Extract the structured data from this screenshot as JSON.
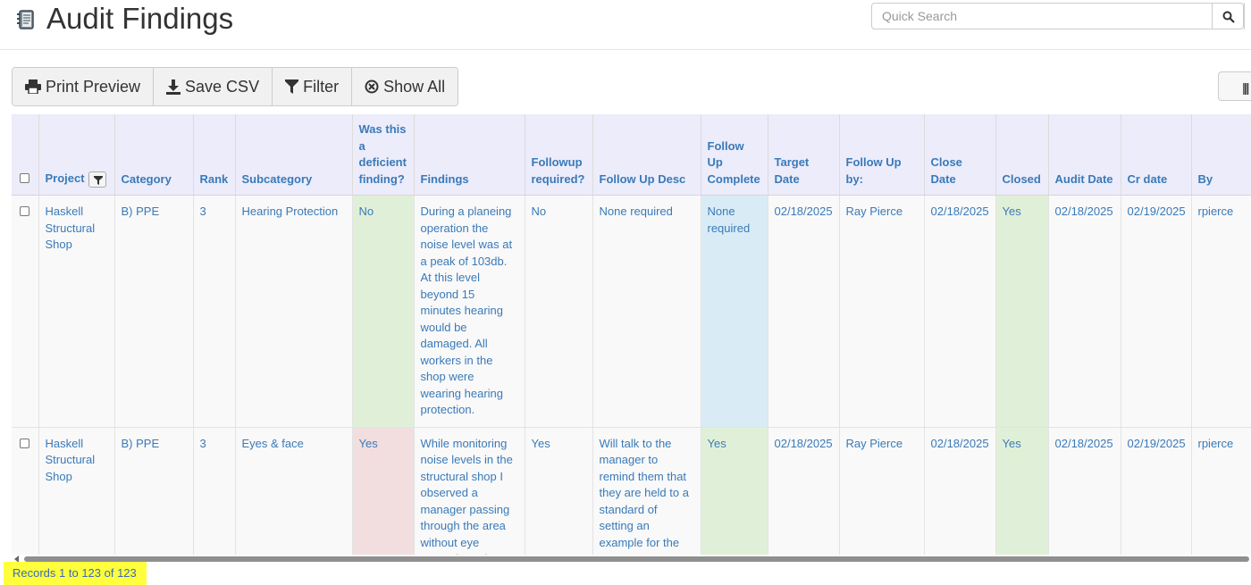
{
  "page": {
    "title": "Audit Findings",
    "icon": "audit-book-icon"
  },
  "search": {
    "placeholder": "Quick Search",
    "value": ""
  },
  "toolbar": {
    "print_label": "Print Preview",
    "save_label": "Save CSV",
    "filter_label": "Filter",
    "show_all_label": "Show All"
  },
  "table": {
    "columns": [
      "Project",
      "Category",
      "Rank",
      "Subcategory",
      "Was this a deficient finding?",
      "Findings",
      "Followup required?",
      "Follow Up Desc",
      "Follow Up Complete",
      "Target Date",
      "Follow Up by:",
      "Close Date",
      "Closed",
      "Audit Date",
      "Cr date",
      "By"
    ],
    "rows": [
      {
        "project": "Haskell Structural Shop",
        "category": "B) PPE",
        "rank": "3",
        "subcategory": "Hearing Protection",
        "deficient": "No",
        "findings": "During a planeing operation the noise level was at a peak of 103db. At this level beyond 15 minutes hearing would be damaged. All workers in the shop were wearing hearing protection.",
        "followup_required": "No",
        "followup_desc": "None required",
        "followup_complete": "None required",
        "target_date": "02/18/2025",
        "followup_by": "Ray Pierce",
        "close_date": "02/18/2025",
        "closed": "Yes",
        "audit_date": "02/18/2025",
        "cr_date": "02/19/2025",
        "by": "rpierce"
      },
      {
        "project": "Haskell Structural Shop",
        "category": "B) PPE",
        "rank": "3",
        "subcategory": "Eyes & face",
        "deficient": "Yes",
        "findings": "While monitoring noise levels in the structural shop I observed a manager passing through the area without eye protection. The",
        "followup_required": "Yes",
        "followup_desc": "Will talk to the manager to remind them that they are held to a standard of setting an example for the crews",
        "followup_complete": "Yes",
        "target_date": "02/18/2025",
        "followup_by": "Ray Pierce",
        "close_date": "02/18/2025",
        "closed": "Yes",
        "audit_date": "02/18/2025",
        "cr_date": "02/19/2025",
        "by": "rpierce"
      }
    ]
  },
  "footer": {
    "records_text": "Records 1 to 123 of 123"
  },
  "colors": {
    "link": "#3a7ab8",
    "header_bg": "#ececfb",
    "green_cell": "#e0f0d8",
    "red_cell": "#f2dede",
    "blue_cell": "#d9ecf6",
    "highlight": "#ffff3d"
  }
}
